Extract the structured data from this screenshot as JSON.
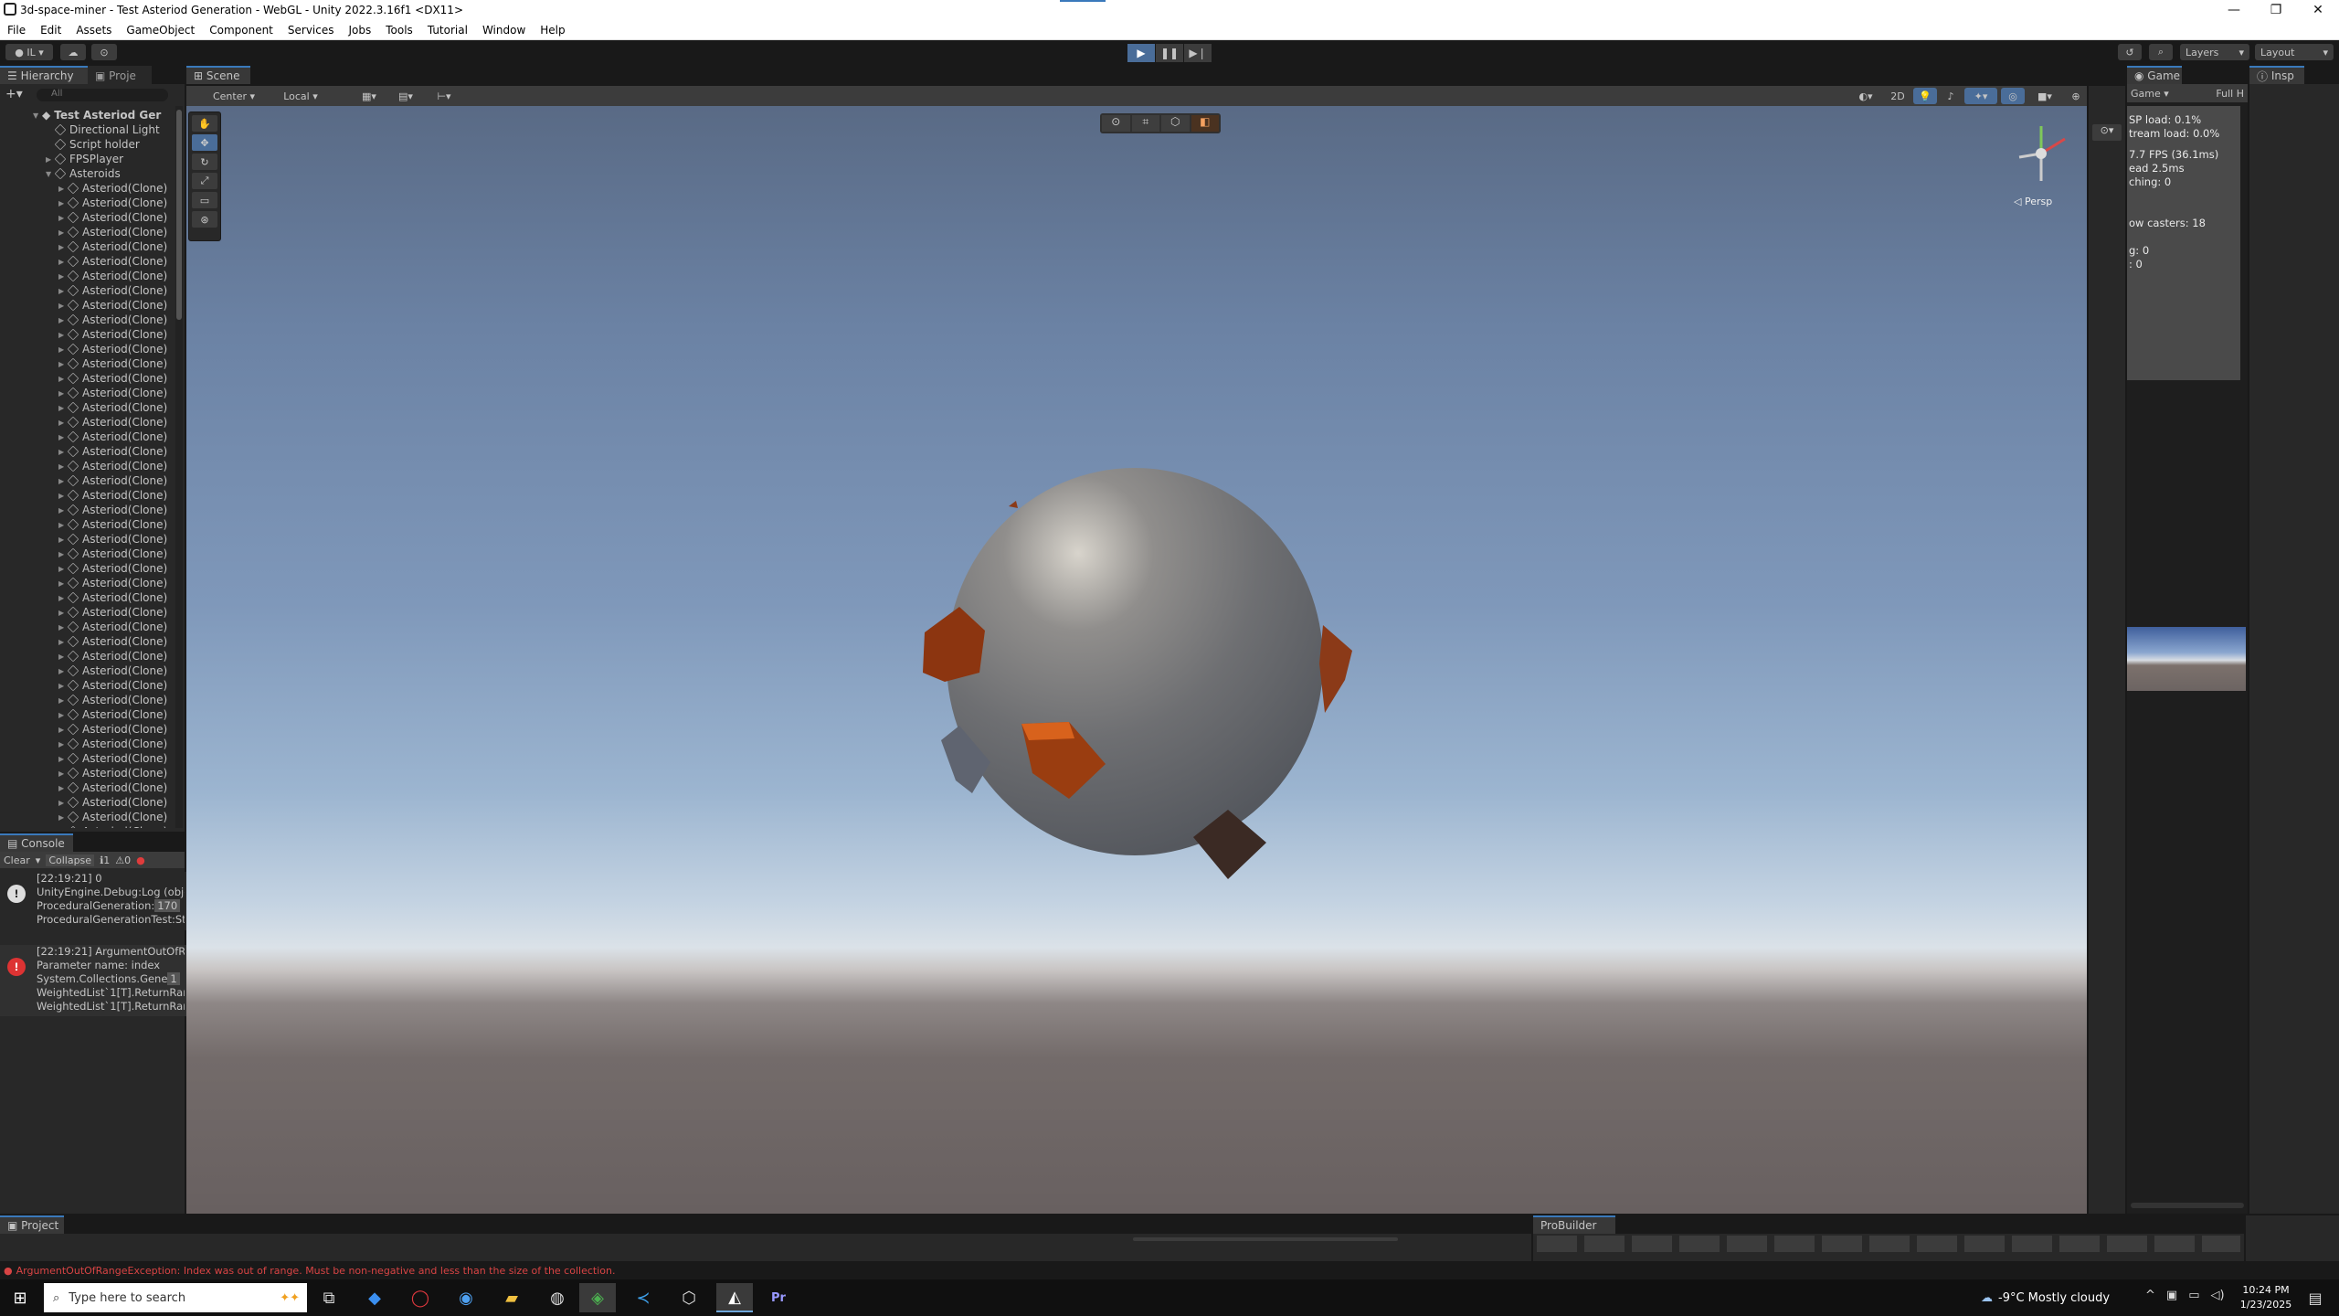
{
  "window": {
    "title": "3d-space-miner - Test Asteriod Generation - WebGL - Unity 2022.3.16f1 <DX11>",
    "minimize": "—",
    "maximize": "❐",
    "close": "✕"
  },
  "menu": [
    "File",
    "Edit",
    "Assets",
    "GameObject",
    "Component",
    "Services",
    "Jobs",
    "Tools",
    "Tutorial",
    "Window",
    "Help"
  ],
  "toolbar": {
    "account": "IL",
    "layers": "Layers",
    "layout": "Layout"
  },
  "hierarchy": {
    "tab": "Hierarchy",
    "tab2": "Proje",
    "search_placeholder": "All",
    "scene_name": "Test Asteriod Ger",
    "items": [
      "Directional Light",
      "Script holder",
      "FPSPlayer",
      "Asteroids"
    ],
    "clone_label": "Asteriod(Clone)",
    "clone_count_visible": 45
  },
  "scene": {
    "tab": "Scene",
    "pivot": "Center",
    "space": "Local",
    "mode_2d": "2D",
    "persp": "Persp"
  },
  "console": {
    "tab": "Console",
    "clear": "Clear",
    "collapse": "Collapse",
    "count_info": "1",
    "count_warn": "0",
    "entries": [
      {
        "type": "info",
        "lines": [
          "[22:19:21] 0",
          "UnityEngine.Debug:Log (obje",
          "ProceduralGeneration:",
          "ProceduralGenerationTest:St"
        ],
        "badge": "170"
      },
      {
        "type": "error",
        "lines": [
          "[22:19:21] ArgumentOutOfRar",
          "Parameter name: index",
          "System.Collections.Gene",
          "WeightedList`1[T].ReturnRan",
          "WeightedList`1[T].ReturnRan"
        ],
        "badge": "1"
      }
    ]
  },
  "game": {
    "tab": "Game",
    "display": "Game",
    "aspect": "Full H",
    "stats": [
      "SP load: 0.1%",
      "tream load: 0.0%",
      "7.7 FPS (36.1ms)",
      "ead 2.5ms",
      "ching: 0",
      "ow casters: 18",
      "g: 0",
      ": 0"
    ]
  },
  "inspector": {
    "tab": "Insp"
  },
  "bottom": {
    "project_tab": "Project",
    "probuilder_tab": "ProBuilder",
    "status_error": "ArgumentOutOfRangeException: Index was out of range. Must be non-negative and less than the size of the collection."
  },
  "taskbar": {
    "search_placeholder": "Type here to search",
    "weather": "-9°C  Mostly cloudy",
    "time": "10:24 PM",
    "date": "1/23/2025"
  }
}
